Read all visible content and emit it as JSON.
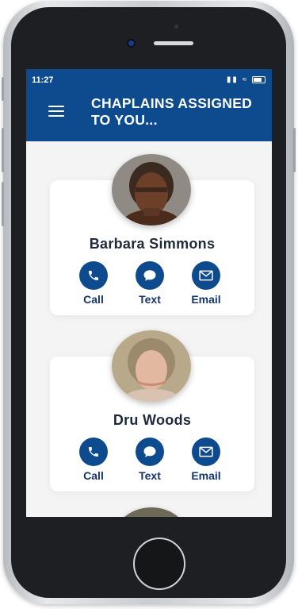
{
  "status": {
    "time": "11:27"
  },
  "header": {
    "title": "CHAPLAINS ASSIGNED TO YOU..."
  },
  "chaplains": [
    {
      "name": "Barbara Simmons",
      "actions": {
        "call": "Call",
        "text": "Text",
        "email": "Email"
      }
    },
    {
      "name": "Dru Woods",
      "actions": {
        "call": "Call",
        "text": "Text",
        "email": "Email"
      }
    }
  ],
  "colors": {
    "header": "#0d4b8e",
    "action_button": "#0d4b8e",
    "background": "#f4f4f5"
  },
  "icons": [
    "menu-icon",
    "phone-icon",
    "speech-bubble-icon",
    "envelope-icon"
  ]
}
